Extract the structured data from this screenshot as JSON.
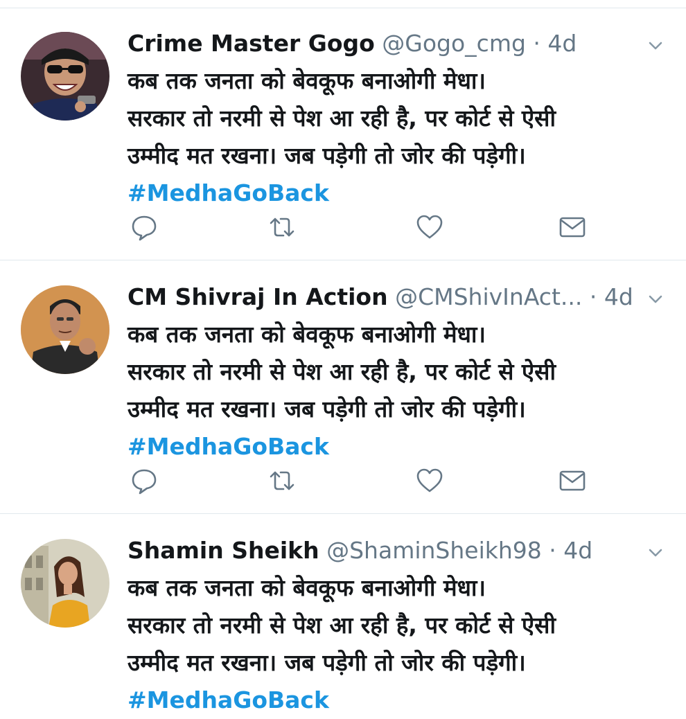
{
  "tweets": [
    {
      "name": "Crime Master Gogo",
      "handle": "@Gogo_cmg",
      "separator": "·",
      "time": "4d",
      "text_lines": [
        "कब तक जनता को बेवकूफ बनाओगी मेधा।",
        "सरकार तो नरमी से पेश आ रही है, पर कोर्ट से ऐसी",
        "उम्मीद मत रखना। जब पड़ेगी तो जोर की पड़ेगी।"
      ],
      "hashtag": "#MedhaGoBack",
      "avatar_icon": "villain-avatar"
    },
    {
      "name": "CM Shivraj In Action",
      "handle": "@CMShivInAct...",
      "separator": "·",
      "time": "4d",
      "text_lines": [
        "कब तक जनता को बेवकूफ बनाओगी मेधा।",
        "सरकार तो नरमी से पेश आ रही है, पर कोर्ट से ऐसी",
        "उम्मीद मत रखना। जब पड़ेगी तो जोर की पड़ेगी।"
      ],
      "hashtag": "#MedhaGoBack",
      "avatar_icon": "politician-avatar"
    },
    {
      "name": "Shamin Sheikh",
      "handle": "@ShaminSheikh98",
      "separator": "·",
      "time": "4d",
      "text_lines": [
        "कब तक जनता को बेवकूफ बनाओगी मेधा।",
        "सरकार तो नरमी से पेश आ रही है, पर कोर्ट से ऐसी",
        "उम्मीद मत रखना। जब पड़ेगी तो जोर की पड़ेगी।"
      ],
      "hashtag": "#MedhaGoBack",
      "avatar_icon": "woman-avatar"
    }
  ],
  "icons": {
    "reply": "reply-icon",
    "retweet": "retweet-icon",
    "like": "heart-icon",
    "dm": "envelope-icon",
    "menu": "chevron-down-icon"
  },
  "colors": {
    "link": "#1b95e0",
    "secondary_text": "#657786",
    "divider": "#e1e8ed"
  }
}
